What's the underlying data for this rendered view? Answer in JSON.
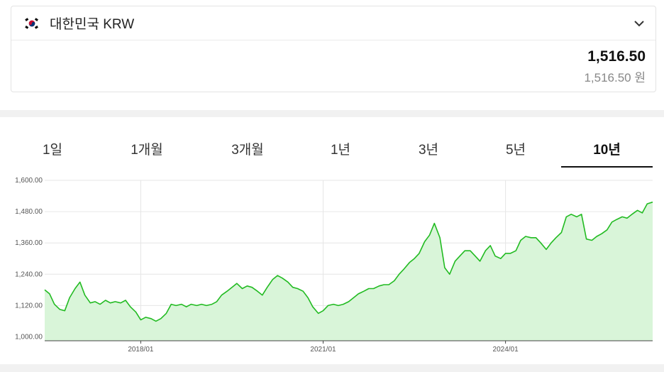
{
  "currency": {
    "name": "대한민국 KRW",
    "flag_icon": "south-korea-flag-icon",
    "amount": "1,516.50",
    "amount_sub": "1,516.50 원"
  },
  "tabs": [
    {
      "label": "1일"
    },
    {
      "label": "1개월"
    },
    {
      "label": "3개월"
    },
    {
      "label": "1년"
    },
    {
      "label": "3년"
    },
    {
      "label": "5년"
    },
    {
      "label": "10년",
      "active": true
    }
  ],
  "colors": {
    "line": "#22bb22",
    "fill": "#d9f5d9",
    "grid": "#e6e6e6"
  },
  "chart_data": {
    "type": "area",
    "title": "",
    "xlabel": "",
    "ylabel": "",
    "ylim": [
      985,
      1600
    ],
    "xlim": [
      2016.42,
      2026.42
    ],
    "y_ticks": [
      "1,600.00",
      "1,480.00",
      "1,360.00",
      "1,240.00",
      "1,120.00",
      "1,000.00"
    ],
    "y_tick_values": [
      1600,
      1480,
      1360,
      1240,
      1120,
      1000
    ],
    "x_ticks": [
      "2018/01",
      "2021/01",
      "2024/01"
    ],
    "x_tick_values": [
      2018.0,
      2021.0,
      2024.0
    ],
    "grid": true,
    "series": [
      {
        "x": [
          2016.42,
          2016.5,
          2016.58,
          2016.67,
          2016.75,
          2016.83,
          2016.92,
          2017.0,
          2017.08,
          2017.17,
          2017.25,
          2017.33,
          2017.42,
          2017.5,
          2017.58,
          2017.67,
          2017.75,
          2017.83,
          2017.92,
          2018.0,
          2018.08,
          2018.17,
          2018.25,
          2018.33,
          2018.42,
          2018.5,
          2018.58,
          2018.67,
          2018.75,
          2018.83,
          2018.92,
          2019.0,
          2019.08,
          2019.17,
          2019.25,
          2019.33,
          2019.42,
          2019.5,
          2019.58,
          2019.67,
          2019.75,
          2019.83,
          2019.92,
          2020.0,
          2020.08,
          2020.17,
          2020.25,
          2020.33,
          2020.42,
          2020.5,
          2020.58,
          2020.67,
          2020.75,
          2020.83,
          2020.92,
          2021.0,
          2021.08,
          2021.17,
          2021.25,
          2021.33,
          2021.42,
          2021.5,
          2021.58,
          2021.67,
          2021.75,
          2021.83,
          2021.92,
          2022.0,
          2022.08,
          2022.17,
          2022.25,
          2022.33,
          2022.42,
          2022.5,
          2022.58,
          2022.67,
          2022.75,
          2022.83,
          2022.92,
          2023.0,
          2023.08,
          2023.17,
          2023.25,
          2023.33,
          2023.42,
          2023.5,
          2023.58,
          2023.67,
          2023.75,
          2023.83,
          2023.92,
          2024.0,
          2024.08,
          2024.17,
          2024.25,
          2024.33,
          2024.42,
          2024.5,
          2024.58,
          2024.67,
          2024.75,
          2024.83,
          2024.92,
          2025.0,
          2025.08,
          2025.17,
          2025.25,
          2025.33,
          2025.42,
          2025.5,
          2025.58,
          2025.67,
          2025.75,
          2025.83,
          2025.92,
          2026.0,
          2026.08,
          2026.17,
          2026.25,
          2026.33,
          2026.42
        ],
        "values": [
          1180,
          1165,
          1125,
          1105,
          1100,
          1150,
          1185,
          1210,
          1160,
          1130,
          1135,
          1125,
          1140,
          1130,
          1135,
          1130,
          1140,
          1115,
          1095,
          1065,
          1075,
          1070,
          1060,
          1070,
          1090,
          1125,
          1120,
          1125,
          1115,
          1125,
          1120,
          1125,
          1120,
          1125,
          1135,
          1160,
          1175,
          1190,
          1205,
          1185,
          1195,
          1190,
          1175,
          1160,
          1190,
          1220,
          1235,
          1225,
          1210,
          1190,
          1185,
          1175,
          1150,
          1115,
          1090,
          1100,
          1120,
          1125,
          1120,
          1125,
          1135,
          1150,
          1165,
          1175,
          1185,
          1185,
          1195,
          1200,
          1200,
          1215,
          1240,
          1260,
          1285,
          1300,
          1320,
          1365,
          1390,
          1435,
          1380,
          1265,
          1240,
          1290,
          1310,
          1330,
          1330,
          1310,
          1290,
          1330,
          1350,
          1310,
          1300,
          1320,
          1320,
          1330,
          1370,
          1385,
          1380,
          1380,
          1360,
          1335,
          1360,
          1380,
          1400,
          1460,
          1470,
          1460,
          1470,
          1375,
          1370,
          1385,
          1395,
          1410,
          1440,
          1450,
          1460,
          1455,
          1470,
          1485,
          1475,
          1510,
          1516.5
        ]
      }
    ]
  }
}
